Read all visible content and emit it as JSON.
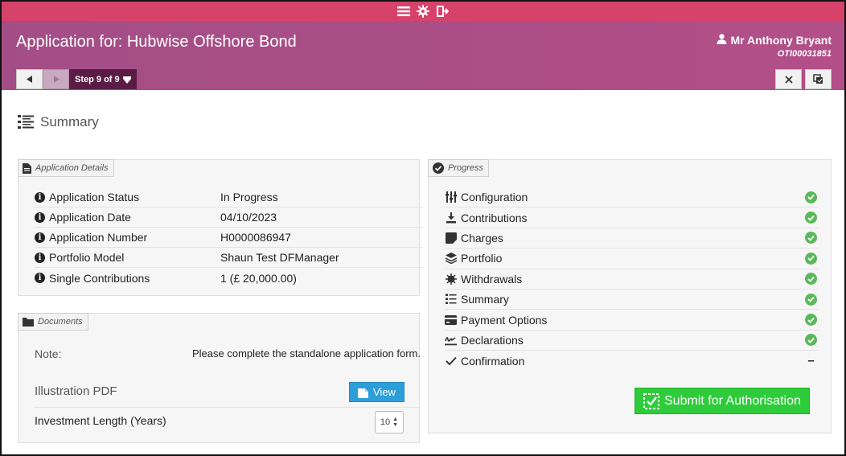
{
  "colors": {
    "topbar": "#d6426a",
    "header": "#a34d86",
    "step_label_bg": "#5a1c45",
    "view_button": "#2d9fd8",
    "submit_button": "#2ecc3a",
    "check": "#5cb85c"
  },
  "topbar": {
    "icons": [
      "menu-icon",
      "gear-icon",
      "exit-icon"
    ]
  },
  "header": {
    "title": "Application for: Hubwise Offshore Bond",
    "user_name": "Mr Anthony Bryant",
    "user_ref": "OTI00031851",
    "step_label": "Step 9 of 9"
  },
  "page": {
    "heading": "Summary"
  },
  "application_details": {
    "title": "Application Details",
    "rows": [
      {
        "label": "Application Status",
        "value": "In Progress"
      },
      {
        "label": "Application Date",
        "value": "04/10/2023"
      },
      {
        "label": "Application Number",
        "value": "H0000086947"
      },
      {
        "label": "Portfolio Model",
        "value": "Shaun Test DFManager"
      },
      {
        "label": "Single Contributions",
        "value": "1 (£ 20,000.00)"
      }
    ]
  },
  "documents": {
    "title": "Documents",
    "note_label": "Note:",
    "note_text": "Please complete the standalone application form.",
    "illustration_label": "Illustration PDF",
    "view_label": "View",
    "investment_label": "Investment Length (Years)",
    "investment_value": "10"
  },
  "progress": {
    "title": "Progress",
    "items": [
      {
        "label": "Configuration",
        "icon": "sliders-icon",
        "status": "complete"
      },
      {
        "label": "Contributions",
        "icon": "download-icon",
        "status": "complete"
      },
      {
        "label": "Charges",
        "icon": "charges-icon",
        "status": "complete"
      },
      {
        "label": "Portfolio",
        "icon": "layers-icon",
        "status": "complete"
      },
      {
        "label": "Withdrawals",
        "icon": "withdrawals-icon",
        "status": "complete"
      },
      {
        "label": "Summary",
        "icon": "list-icon",
        "status": "complete"
      },
      {
        "label": "Payment Options",
        "icon": "card-icon",
        "status": "complete"
      },
      {
        "label": "Declarations",
        "icon": "signature-icon",
        "status": "complete"
      },
      {
        "label": "Confirmation",
        "icon": "checkmark-icon",
        "status": "pending"
      }
    ],
    "submit_label": "Submit for Authorisation"
  }
}
